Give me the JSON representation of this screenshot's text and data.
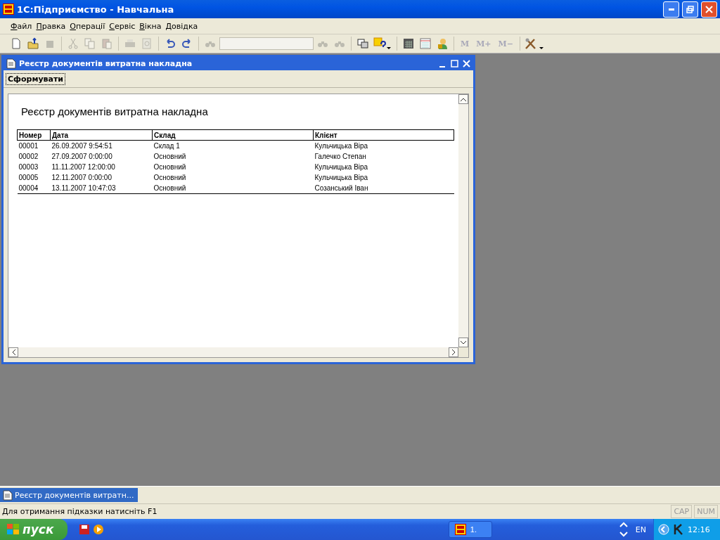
{
  "window": {
    "title": "1С:Підприємство - Навчальна"
  },
  "menu": [
    {
      "label": "Файл"
    },
    {
      "label": "Правка"
    },
    {
      "label": "Операції"
    },
    {
      "label": "Сервіс"
    },
    {
      "label": "Вікна"
    },
    {
      "label": "Довідка"
    }
  ],
  "toolbar": [
    {
      "kind": "new",
      "disabled": false
    },
    {
      "kind": "open",
      "disabled": false
    },
    {
      "kind": "save",
      "disabled": true
    },
    {
      "kind": "sep"
    },
    {
      "kind": "cut",
      "disabled": true
    },
    {
      "kind": "copy",
      "disabled": true
    },
    {
      "kind": "paste",
      "disabled": true
    },
    {
      "kind": "sep"
    },
    {
      "kind": "print",
      "disabled": true
    },
    {
      "kind": "preview",
      "disabled": true
    },
    {
      "kind": "sep"
    },
    {
      "kind": "undo",
      "disabled": false
    },
    {
      "kind": "redo",
      "disabled": false
    },
    {
      "kind": "sep"
    },
    {
      "kind": "find",
      "disabled": true
    },
    {
      "kind": "search"
    },
    {
      "kind": "findprev",
      "disabled": true
    },
    {
      "kind": "findnext",
      "disabled": true
    },
    {
      "kind": "sep"
    },
    {
      "kind": "windows",
      "disabled": false
    },
    {
      "kind": "help",
      "disabled": false
    },
    {
      "kind": "sep"
    },
    {
      "kind": "calculator",
      "disabled": false
    },
    {
      "kind": "calendar",
      "disabled": false
    },
    {
      "kind": "user",
      "disabled": false
    },
    {
      "kind": "sep"
    },
    {
      "kind": "text",
      "label": "M",
      "disabled": true
    },
    {
      "kind": "text",
      "label": "M+",
      "disabled": true
    },
    {
      "kind": "text",
      "label": "M−",
      "disabled": true
    },
    {
      "kind": "sep"
    },
    {
      "kind": "tools",
      "disabled": false
    }
  ],
  "child_window": {
    "title": "Реєстр документів витратна накладна",
    "button": "Сформувати",
    "report": {
      "title": "Реєстр документів витратна накладна",
      "columns": [
        "Номер",
        "Дата",
        "Склад",
        "Клієнт"
      ],
      "rows": [
        [
          "00001",
          "26.09.2007 9:54:51",
          "Склад 1",
          "Кульчицька Віра"
        ],
        [
          "00002",
          "27.09.2007 0:00:00",
          "Основний",
          "Галечко Степан"
        ],
        [
          "00003",
          "11.11.2007 12:00:00",
          "Основний",
          "Кульчицька Віра"
        ],
        [
          "00005",
          "12.11.2007 0:00:00",
          "Основний",
          "Кульчицька Віра"
        ],
        [
          "00004",
          "13.11.2007 10:47:03",
          "Основний",
          "Созанський Іван"
        ]
      ]
    }
  },
  "window_bar": [
    {
      "label": "Реєстр документів витратн...",
      "selected": true
    }
  ],
  "status_bar": {
    "hint": "Для отримання підказки натисніть F1",
    "indicators": [
      "CAP",
      "NUM"
    ]
  },
  "taskbar": {
    "start": "пуск",
    "tasks": [
      {
        "label": "1.",
        "selected": false
      }
    ],
    "language": "EN",
    "clock": "12:16"
  }
}
